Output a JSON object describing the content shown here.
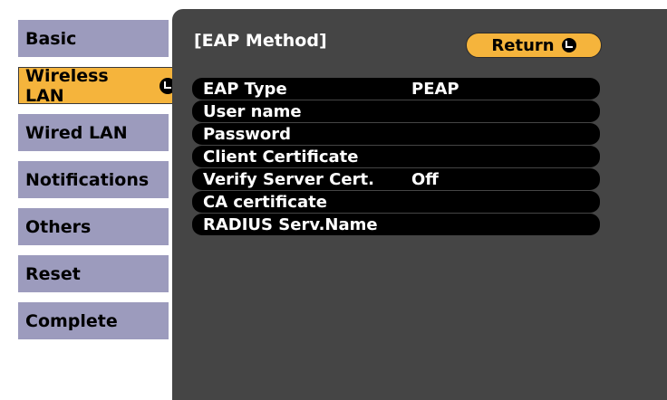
{
  "sidebar": {
    "items": [
      {
        "label": "Basic",
        "active": false
      },
      {
        "label": "Wireless LAN",
        "active": true
      },
      {
        "label": "Wired LAN",
        "active": false
      },
      {
        "label": "Notifications",
        "active": false
      },
      {
        "label": "Others",
        "active": false
      },
      {
        "label": "Reset",
        "active": false
      },
      {
        "label": "Complete",
        "active": false
      }
    ]
  },
  "panel": {
    "title": "[EAP Method]",
    "return_label": "Return",
    "rows": [
      {
        "label": "EAP Type",
        "value": "PEAP"
      },
      {
        "label": "User name",
        "value": ""
      },
      {
        "label": "Password",
        "value": ""
      },
      {
        "label": "Client Certificate",
        "value": ""
      },
      {
        "label": "Verify Server Cert.",
        "value": "Off"
      },
      {
        "label": "CA certificate",
        "value": ""
      },
      {
        "label": "RADIUS Serv.Name",
        "value": ""
      }
    ]
  },
  "colors": {
    "active_tab": "#f5b43c",
    "inactive_tab": "#9c9bbd",
    "panel_bg": "#454545",
    "row_bg": "#000000"
  },
  "icons": {
    "enter": "enter-icon"
  }
}
